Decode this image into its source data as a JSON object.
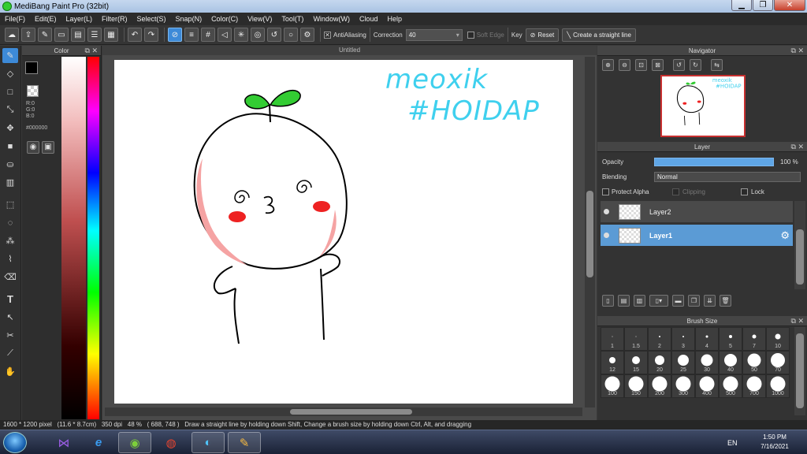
{
  "window": {
    "title": "MediBang Paint Pro (32bit)",
    "controls": {
      "minimize": "▁",
      "maximize": "❐",
      "close": "✕"
    }
  },
  "menu": [
    "File(F)",
    "Edit(E)",
    "Layer(L)",
    "Filter(R)",
    "Select(S)",
    "Snap(N)",
    "Color(C)",
    "View(V)",
    "Tool(T)",
    "Window(W)",
    "Cloud",
    "Help"
  ],
  "toolbar": {
    "antialiasing": "AntiAliasing",
    "antialiasing_checked": "✕",
    "correction_label": "Correction",
    "correction_value": "40",
    "soft_edge": "Soft Edge",
    "key": "Key",
    "reset": "Reset",
    "straight_line": "Create a straight line",
    "icons": [
      "cloud-icon",
      "export-icon",
      "comment-icon",
      "screen-icon",
      "page-icon",
      "list-icon",
      "grid-icon",
      "undo-icon",
      "redo-icon",
      "snap-off-icon",
      "parallel-snap-icon",
      "grid-snap-icon",
      "vanish-snap-icon",
      "radial-snap-icon",
      "concentric-snap-icon",
      "curve-snap-icon",
      "circle-snap-icon",
      "snap-settings-icon"
    ]
  },
  "colorPanel": {
    "title": "Color",
    "r": "R:0",
    "g": "G:0",
    "b": "B:0",
    "hex": "#000000",
    "fg_color": "#000000",
    "bg_color": "#e8236f"
  },
  "canvas": {
    "tab_title": "Untitled",
    "watermark_line1": "meoxik",
    "watermark_line2": "#HOIDAP",
    "watermark_color": "#3fd0ee"
  },
  "navigator": {
    "title": "Navigator"
  },
  "layerPanel": {
    "title": "Layer",
    "opacity_label": "Opacity",
    "opacity_value": "100 %",
    "opacity_level": 1.0,
    "blending_label": "Blending",
    "blending_value": "Normal",
    "protect_alpha": "Protect Alpha",
    "clipping": "Clipping",
    "lock": "Lock",
    "layers": [
      {
        "name": "Layer2",
        "selected": false
      },
      {
        "name": "Layer1",
        "selected": true
      }
    ]
  },
  "brushSize": {
    "title": "Brush Size",
    "sizes": [
      "1",
      "1.5",
      "2",
      "3",
      "4",
      "5",
      "7",
      "10",
      "12",
      "15",
      "20",
      "25",
      "30",
      "40",
      "50",
      "70",
      "100",
      "150",
      "200",
      "300",
      "400",
      "500",
      "700",
      "1000"
    ]
  },
  "status": {
    "size": "1600 * 1200 pixel",
    "physical": "(11.6 * 8.7cm)",
    "dpi": "350 dpi",
    "zoom": "48 %",
    "coords": "( 688, 748 )",
    "hint": "Draw a straight line by holding down Shift, Change a brush size by holding down Ctrl, Alt, and dragging"
  },
  "taskbar": {
    "language": "EN",
    "time": "1:50 PM",
    "date": "7/16/2021"
  }
}
